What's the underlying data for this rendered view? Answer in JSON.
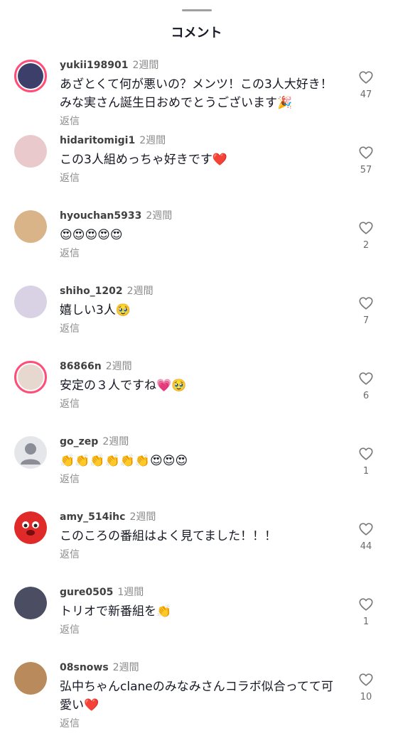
{
  "header": {
    "title": "コメント"
  },
  "reply_label": "返信",
  "comments": [
    {
      "user": "yukii198901",
      "time": "2週間",
      "text": "あざとくて何が悪いの？メンツ！この3人大好き！みな実さん誕生日おめでとうございます🎉",
      "likes": "47",
      "ring": true,
      "avatar_color": "#3b3f6a"
    },
    {
      "user": "hidaritomigi1",
      "time": "2週間",
      "text": "この3人組めっちゃ好きです❤️",
      "likes": "57",
      "ring": false,
      "avatar_color": "#e9c9cc"
    },
    {
      "user": "hyouchan5933",
      "time": "2週間",
      "text": "😍😍😍😍😍",
      "likes": "2",
      "ring": false,
      "avatar_color": "#d8b488"
    },
    {
      "user": "shiho_1202",
      "time": "2週間",
      "text": "嬉しい3人🥹",
      "likes": "7",
      "ring": false,
      "avatar_color": "#d9d2e4"
    },
    {
      "user": "86866n",
      "time": "2週間",
      "text": "安定の３人ですね💗🥹",
      "likes": "6",
      "ring": true,
      "avatar_color": "#e6d8cf"
    },
    {
      "user": "go_zep",
      "time": "2週間",
      "text": "👏👏👏👏👏👏😍😍😍",
      "likes": "1",
      "ring": false,
      "avatar_color": "#e5e6ea"
    },
    {
      "user": "amy_514ihc",
      "time": "2週間",
      "text": "このころの番組はよく見てました！！！",
      "likes": "44",
      "ring": false,
      "avatar_color": "#e02a2a"
    },
    {
      "user": "gure0505",
      "time": "1週間",
      "text": "トリオで新番組を👏",
      "likes": "1",
      "ring": false,
      "avatar_color": "#4b4e63"
    },
    {
      "user": "08snows",
      "time": "2週間",
      "text": "弘中ちゃんclaneのみなみさんコラボ似合ってて可愛い❤️",
      "likes": "10",
      "ring": false,
      "avatar_color": "#b98a5c"
    }
  ],
  "icons": {
    "like": "heart-outline-icon",
    "default_avatar": "person-silhouette-icon"
  },
  "colors": {
    "avatar_ring": "#ff4d78",
    "text": "#161823",
    "muted": "#8a8a8a"
  }
}
